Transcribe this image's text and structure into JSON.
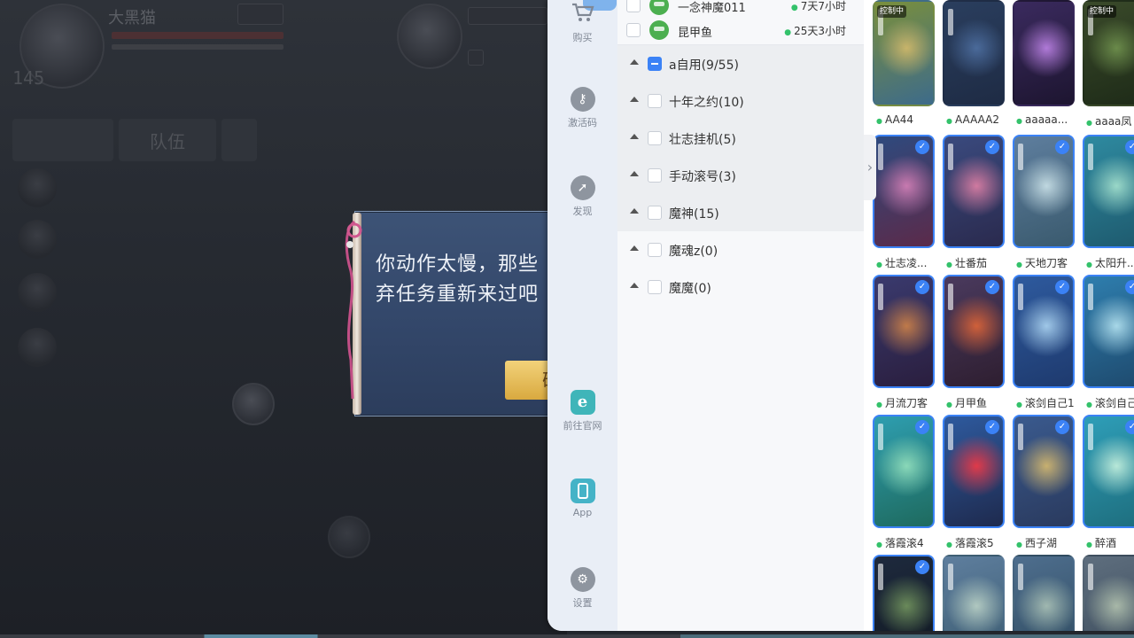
{
  "game": {
    "player1": {
      "name": "大黑猫",
      "level": "145"
    },
    "tab_team": "队伍",
    "dialog": {
      "line1": "你动作太慢，那些",
      "line2": "弃任务重新来过吧",
      "button": "确"
    }
  },
  "sidebar": {
    "items": [
      {
        "label": "购买",
        "icon": "cart-icon"
      },
      {
        "label": "激活码",
        "icon": "key-icon"
      },
      {
        "label": "发现",
        "icon": "compass-icon"
      },
      {
        "label": "前往官网",
        "icon": "ie-icon"
      },
      {
        "label": "App",
        "icon": "phone-icon"
      },
      {
        "label": "设置",
        "icon": "gear-icon"
      }
    ]
  },
  "devices": [
    {
      "name": "一念神魔011",
      "time": "7天7小时"
    },
    {
      "name": "昆甲鱼",
      "time": "25天3小时"
    }
  ],
  "groups": [
    {
      "label": "a自用(9/55)",
      "state": "partial"
    },
    {
      "label": "十年之约(10)",
      "state": "none"
    },
    {
      "label": "壮志挂机(5)",
      "state": "none"
    },
    {
      "label": "手动滚号(3)",
      "state": "none"
    },
    {
      "label": "魔神(15)",
      "state": "none"
    },
    {
      "label": "魔魂z(0)",
      "state": "none"
    },
    {
      "label": "魔魔(0)",
      "state": "none"
    }
  ],
  "control_tag": "控制中",
  "thumbnails": [
    {
      "name": "AA44",
      "selected": false,
      "control": true,
      "colors": [
        "#7a8f3c",
        "#c8b46a",
        "#3d6b8a"
      ]
    },
    {
      "name": "AAAAA2",
      "selected": false,
      "control": false,
      "colors": [
        "#2a3e5e",
        "#4a6a9a",
        "#1e2b44"
      ]
    },
    {
      "name": "aaaaa...",
      "selected": false,
      "control": false,
      "colors": [
        "#3a2a5e",
        "#b07ad8",
        "#1d1530"
      ]
    },
    {
      "name": "aaaa凤",
      "selected": false,
      "control": true,
      "colors": [
        "#3a4a2a",
        "#6a8a4a",
        "#1e2b18"
      ]
    },
    {
      "name": "壮志凌...",
      "selected": true,
      "control": false,
      "colors": [
        "#2e4a7e",
        "#c87ab0",
        "#5b2a4a"
      ]
    },
    {
      "name": "壮番茄",
      "selected": true,
      "control": false,
      "colors": [
        "#3a4a7e",
        "#d07aa0",
        "#2a2a4e"
      ]
    },
    {
      "name": "天地刀客",
      "selected": true,
      "control": false,
      "colors": [
        "#5e7e9e",
        "#c0d8e0",
        "#3a5a6e"
      ]
    },
    {
      "name": "太阳升...",
      "selected": true,
      "control": false,
      "colors": [
        "#2e8aa0",
        "#9ad8c8",
        "#1e5a6e"
      ]
    },
    {
      "name": "月流刀客",
      "selected": true,
      "control": false,
      "colors": [
        "#3a3a6e",
        "#c07a4a",
        "#2a1e3e"
      ]
    },
    {
      "name": "月甲鱼",
      "selected": true,
      "control": false,
      "colors": [
        "#4a3a5e",
        "#d0603a",
        "#2e1e30"
      ]
    },
    {
      "name": "滚剑自己1",
      "selected": true,
      "control": false,
      "colors": [
        "#2e5a9e",
        "#a0c8e8",
        "#1e3a6e"
      ]
    },
    {
      "name": "滚剑自己",
      "selected": true,
      "control": false,
      "colors": [
        "#2e7eae",
        "#a8d8e8",
        "#1e4a6e"
      ]
    },
    {
      "name": "落霞滚4",
      "selected": true,
      "control": false,
      "colors": [
        "#2e9eb0",
        "#8ad8b8",
        "#1e6a5e"
      ]
    },
    {
      "name": "落霞滚5",
      "selected": true,
      "control": false,
      "colors": [
        "#2e5a9e",
        "#e03a4a",
        "#1e2a4e"
      ]
    },
    {
      "name": "西子湖",
      "selected": true,
      "control": false,
      "colors": [
        "#3a5a8e",
        "#c8b070",
        "#2a3a5e"
      ]
    },
    {
      "name": "醉酒",
      "selected": true,
      "control": false,
      "colors": [
        "#2e9eb8",
        "#b8e8d8",
        "#1e6e7e"
      ]
    },
    {
      "name": "",
      "selected": true,
      "control": false,
      "colors": [
        "#1e2a3e",
        "#6a8a5a",
        "#101820"
      ]
    },
    {
      "name": "",
      "selected": false,
      "control": false,
      "colors": [
        "#5e7e9e",
        "#b0c8c0",
        "#3a5a6e"
      ]
    },
    {
      "name": "",
      "selected": false,
      "control": false,
      "colors": [
        "#4e6e8e",
        "#a0b8b0",
        "#2e4a5e"
      ]
    },
    {
      "name": "",
      "selected": false,
      "control": false,
      "colors": [
        "#5e6e7e",
        "#a8b8a8",
        "#3a4a5a"
      ]
    }
  ]
}
